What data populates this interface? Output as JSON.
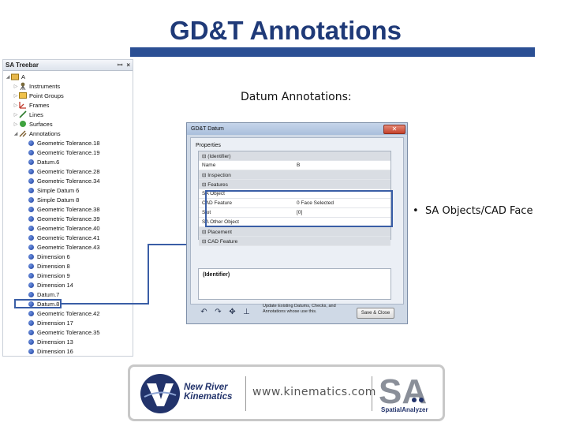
{
  "slide": {
    "title": "GD&T Annotations",
    "datum_caption": "Datum Annotations:",
    "bullet_caption": "SA Objects/CAD Face"
  },
  "treebar": {
    "title": "SA Treebar",
    "pin": "ꟷ",
    "close": "×",
    "root": "A",
    "folders": [
      "Instruments",
      "Point Groups",
      "Frames",
      "Lines",
      "Surfaces",
      "Annotations"
    ],
    "annotations": [
      "Geometric Tolerance.18",
      "Geometric Tolerance.19",
      "Datum.6",
      "Geometric Tolerance.28",
      "Geometric Tolerance.34",
      "Simple Datum 6",
      "Simple Datum 8",
      "Geometric Tolerance.38",
      "Geometric Tolerance.39",
      "Geometric Tolerance.40",
      "Geometric Tolerance.41",
      "Geometric Tolerance.43",
      "Dimension 6",
      "Dimension 8",
      "Dimension 9",
      "Dimension 14",
      "Datum.7",
      "Datum.8",
      "Geometric Tolerance.42",
      "Dimension 17",
      "Geometric Tolerance.35",
      "Dimension 13",
      "Dimension 16"
    ],
    "highlighted": "Datum.8"
  },
  "dialog": {
    "title": "GD&T Datum",
    "close": "✕",
    "properties_label": "Properties",
    "grid": [
      {
        "name": "(Identifier)",
        "value": "",
        "kind": "cat"
      },
      {
        "name": "Name",
        "value": "B",
        "kind": "prop"
      },
      {
        "name": "Inspection",
        "value": "",
        "kind": "cat"
      },
      {
        "name": "Features",
        "value": "",
        "kind": "cat"
      },
      {
        "name": "SA Object",
        "value": "",
        "kind": "sub"
      },
      {
        "name": "CAD Feature",
        "value": "0 Face Selected",
        "kind": "prop"
      },
      {
        "name": "Slot",
        "value": "[0]",
        "kind": "prop"
      },
      {
        "name": "SA Other Object",
        "value": "",
        "kind": "prop"
      },
      {
        "name": "Placement",
        "value": "",
        "kind": "cat"
      },
      {
        "name": "CAD Feature",
        "value": "",
        "kind": "cat"
      }
    ],
    "description_title": "(Identifier)",
    "toolbar": [
      "↶",
      "↷",
      "✥",
      "⊥"
    ],
    "update_note": "Update Existing Datums, Checks, and Annotations whose use this.",
    "save_close": "Save & Close"
  },
  "footer": {
    "company_line1": "New River",
    "company_line2": "Kinematics",
    "url": "www.kinematics.com",
    "sa_letters": "SA",
    "product_name": "SpatialAnalyzer"
  },
  "colors": {
    "title": "#1f3a78",
    "accent_bar": "#2b4f94",
    "highlight": "#3a5ea6",
    "brand_navy": "#22336b"
  }
}
